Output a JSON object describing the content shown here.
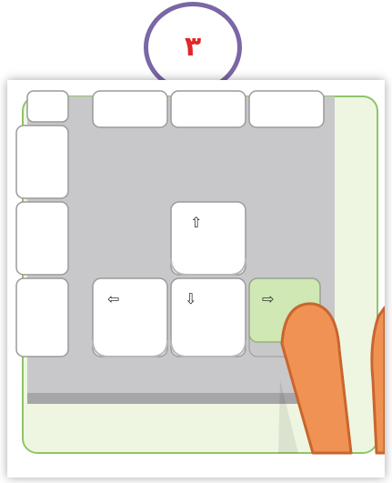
{
  "step": {
    "number": "٣"
  },
  "keyboard": {
    "keys": [
      {
        "name": "up",
        "glyph": "⇧",
        "highlighted": false
      },
      {
        "name": "left",
        "glyph": "⇦",
        "highlighted": false
      },
      {
        "name": "down",
        "glyph": "⇩",
        "highlighted": false
      },
      {
        "name": "right",
        "glyph": "⇨",
        "highlighted": true
      }
    ]
  },
  "colors": {
    "badge_border": "#7b66a6",
    "step_number": "#e02828",
    "keyboard_body": "#c8c8ca",
    "background": "#eef6e2",
    "frame_border": "#8fc46a",
    "key_face": "#ffffff",
    "highlighted_key": "#cfe8b4",
    "finger": "#f19255"
  },
  "icons": [
    "up-arrow-icon",
    "left-arrow-icon",
    "down-arrow-icon",
    "right-arrow-icon",
    "pressing-finger-icon"
  ]
}
